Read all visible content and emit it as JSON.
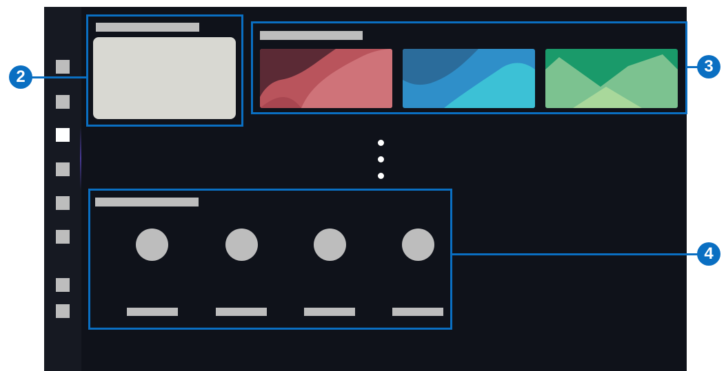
{
  "callouts": {
    "recent_section": "2",
    "featured_section": "3",
    "apps_section": "4"
  },
  "sidebar": {
    "items": [
      {
        "icon": "menu-item-1",
        "selected": false
      },
      {
        "icon": "menu-item-2",
        "selected": false
      },
      {
        "icon": "menu-item-3",
        "selected": true
      },
      {
        "icon": "menu-item-4",
        "selected": false
      },
      {
        "icon": "menu-item-5",
        "selected": false
      },
      {
        "icon": "menu-item-6",
        "selected": false
      },
      {
        "icon": "menu-item-7",
        "selected": false
      },
      {
        "icon": "menu-item-8",
        "selected": false
      }
    ]
  },
  "featured": {
    "tiles": [
      {
        "name": "red-tile",
        "colors": [
          "#b9545c",
          "#cf7379",
          "#5b2a35"
        ]
      },
      {
        "name": "blue-tile",
        "colors": [
          "#2f8fc9",
          "#2b6c9b",
          "#3cc1d6"
        ]
      },
      {
        "name": "green-tile",
        "colors": [
          "#1a9a6a",
          "#7cc290",
          "#a9d89b"
        ]
      }
    ]
  },
  "apps": {
    "count": 4
  },
  "colors": {
    "accent": "#0a6fc2",
    "screen_background": "#0f121a",
    "placeholder": "#bdbdbd",
    "selected": "#ffffff"
  }
}
